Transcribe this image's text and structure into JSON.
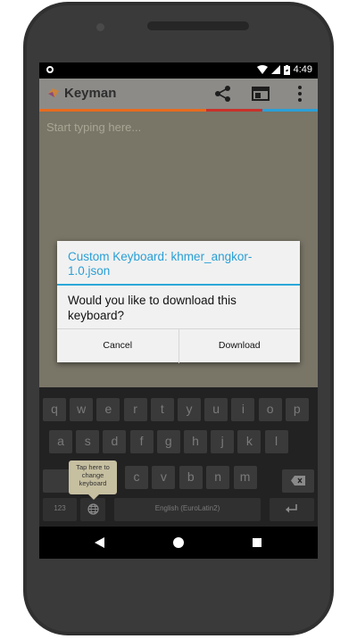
{
  "status_bar": {
    "time": "4:49"
  },
  "app_bar": {
    "title": "Keyman"
  },
  "text_field": {
    "placeholder": "Start typing here..."
  },
  "dialog": {
    "title": "Custom Keyboard: khmer_angkor-1.0.json",
    "message": "Would you like to download this keyboard?",
    "cancel_label": "Cancel",
    "download_label": "Download"
  },
  "keyboard": {
    "row1": [
      "q",
      "w",
      "e",
      "r",
      "t",
      "y",
      "u",
      "i",
      "o",
      "p"
    ],
    "row2": [
      "a",
      "s",
      "d",
      "f",
      "g",
      "h",
      "j",
      "k",
      "l"
    ],
    "row3": [
      "c",
      "v",
      "b",
      "n",
      "m"
    ],
    "numeric_label": "123",
    "spacebar_label": "English (EuroLatin2)",
    "tooltip": "Tap here to change keyboard"
  },
  "colors": {
    "accent": "#2a9fd6",
    "strip": [
      "#e86b1f",
      "#c8312b",
      "#2a9fd6"
    ]
  }
}
